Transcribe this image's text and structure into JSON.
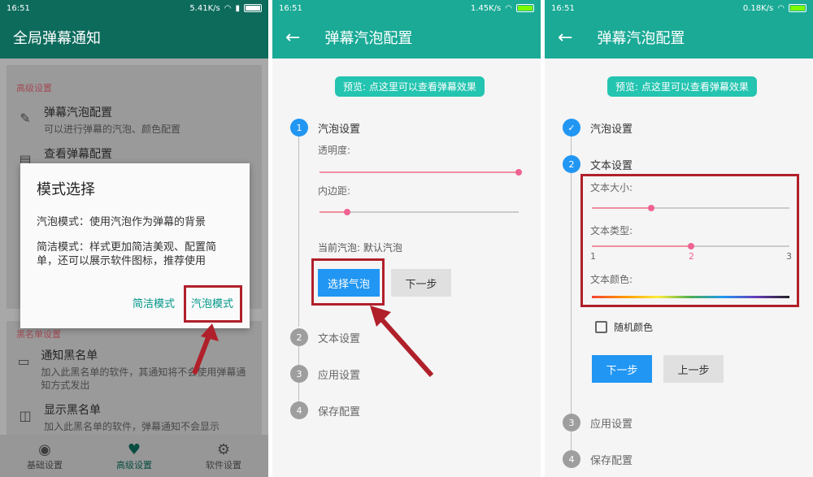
{
  "status": {
    "p1": {
      "time": "16:51",
      "speed": "5.41K/s"
    },
    "p2": {
      "time": "16:51",
      "speed": "1.45K/s"
    },
    "p3": {
      "time": "16:51",
      "speed": "0.18K/s"
    }
  },
  "p1": {
    "title": "全局弹幕通知",
    "section_advanced": "高级设置",
    "items": [
      {
        "title": "弹幕汽泡配置",
        "desc": "可以进行弹幕的汽泡、颜色配置",
        "icon": "bubble-config-icon"
      },
      {
        "title": "查看弹幕配置",
        "desc": "",
        "icon": "view-config-icon"
      }
    ],
    "section_blacklist": "黑名单设置",
    "blacklist_items": [
      {
        "title": "通知黑名单",
        "desc": "加入此黑名单的软件，其通知将不会使用弹幕通知方式发出",
        "icon": "notify-blacklist-icon"
      },
      {
        "title": "显示黑名单",
        "desc": "加入此黑名单的软件，弹幕通知不会显示",
        "icon": "display-blacklist-icon"
      }
    ],
    "dialog": {
      "title": "模式选择",
      "p1": "汽泡模式：使用汽泡作为弹幕的背景",
      "p2": "简洁模式：样式更加简洁美观、配置简单，还可以展示软件图标，推荐使用",
      "btn_simple": "简洁模式",
      "btn_bubble": "汽泡模式"
    },
    "nav": [
      {
        "label": "基础设置",
        "icon": "radio-icon"
      },
      {
        "label": "高级设置",
        "icon": "heart-icon"
      },
      {
        "label": "软件设置",
        "icon": "gear-icon"
      }
    ]
  },
  "p2": {
    "title": "弹幕汽泡配置",
    "preview": "预览: 点这里可以查看弹幕效果",
    "steps": [
      "汽泡设置",
      "文本设置",
      "应用设置",
      "保存配置"
    ],
    "step_nums": [
      "1",
      "2",
      "3",
      "4"
    ],
    "transparency_label": "透明度:",
    "transparency_value": 1.0,
    "padding_label": "内边距:",
    "padding_value": 0.14,
    "current_bubble": "当前汽泡: 默认汽泡",
    "btn_choose": "选择气泡",
    "btn_next": "下一步"
  },
  "p3": {
    "title": "弹幕汽泡配置",
    "preview": "预览: 点这里可以查看弹幕效果",
    "steps": [
      "汽泡设置",
      "文本设置",
      "应用设置",
      "保存配置"
    ],
    "step_nums": [
      "✓",
      "2",
      "3",
      "4"
    ],
    "text_size_label": "文本大小:",
    "text_size_value": 0.3,
    "text_type_label": "文本类型:",
    "text_type_value": 2,
    "text_type_scale": [
      "1",
      "2",
      "3"
    ],
    "text_color_label": "文本颜色:",
    "random_color": "随机颜色",
    "btn_next": "下一步",
    "btn_prev": "上一步"
  },
  "colors": {
    "teal_dark": "#0d6b5c",
    "teal": "#1aaa96",
    "blue": "#2196f3",
    "pink": "#f06292",
    "red_highlight": "#b0202a"
  }
}
